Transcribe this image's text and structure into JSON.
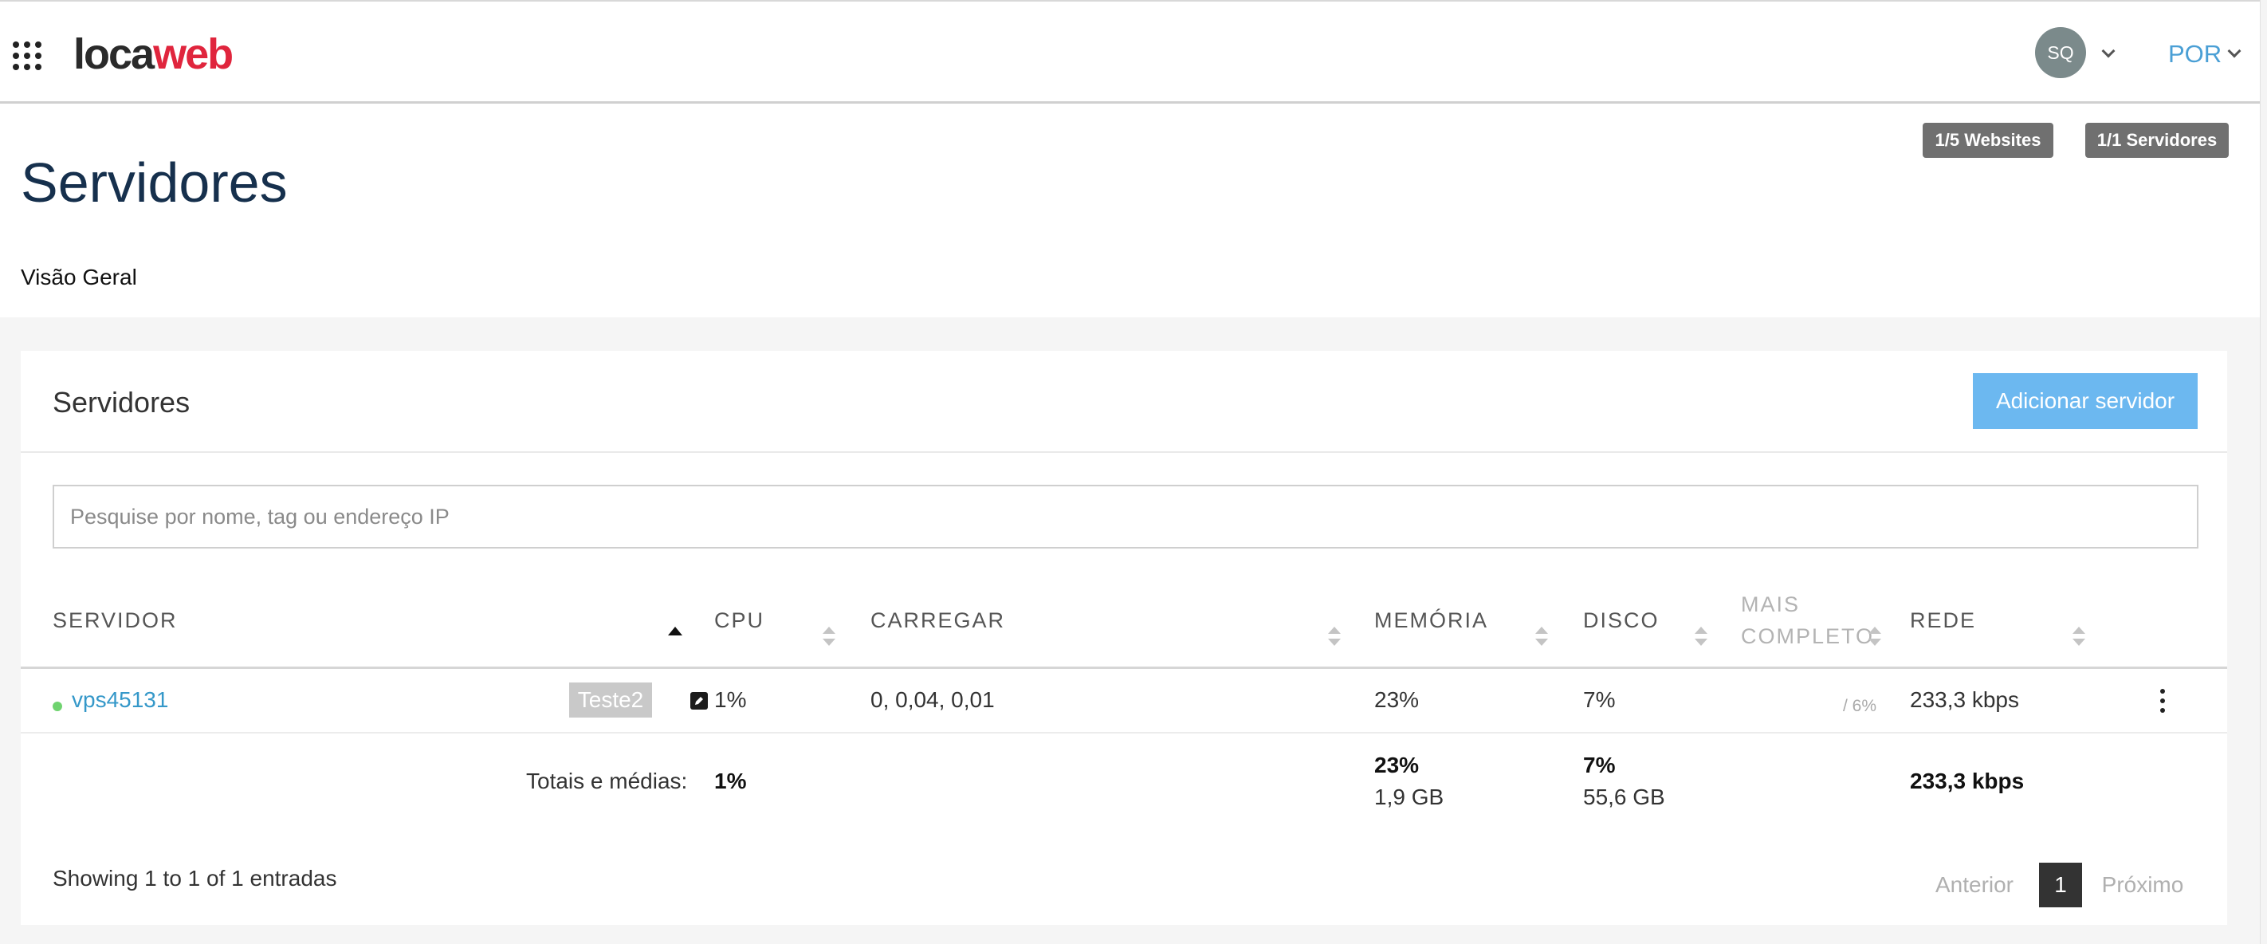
{
  "header": {
    "logo_part1": "loca",
    "logo_part2": "web",
    "avatar_initials": "SQ",
    "language": "POR"
  },
  "badges": {
    "websites": "1/5 Websites",
    "servers": "1/1 Servidores"
  },
  "page": {
    "title": "Servidores",
    "subnav": "Visão Geral"
  },
  "panel": {
    "title": "Servidores",
    "add_button": "Adicionar servidor",
    "search_placeholder": "Pesquise por nome, tag ou endereço IP"
  },
  "table": {
    "columns": {
      "server": "SERVIDOR",
      "cpu": "CPU",
      "load": "CARREGAR",
      "memory": "MEMÓRIA",
      "disk": "DISCO",
      "fullest_line1": "MAIS",
      "fullest_line2": "COMPLETO",
      "network": "REDE"
    },
    "rows": [
      {
        "name": "vps45131",
        "status": "online",
        "tag": "Teste2",
        "cpu": "1%",
        "load": "0, 0,04, 0,01",
        "memory": "23%",
        "disk": "7%",
        "fullest": "/ 6%",
        "network": "233,3 kbps"
      }
    ],
    "totals": {
      "label": "Totais e médias:",
      "cpu": "1%",
      "memory": "23%",
      "memory_size": "1,9 GB",
      "disk": "7%",
      "disk_size": "55,6 GB",
      "network": "233,3 kbps"
    }
  },
  "pagination": {
    "info": "Showing 1 to 1 of 1 entradas",
    "previous": "Anterior",
    "current": "1",
    "next": "Próximo"
  },
  "colors": {
    "brand_red": "#e0253d",
    "link_blue": "#3598c9",
    "button_blue": "#6cb8f0",
    "status_green": "#6fd36f"
  }
}
